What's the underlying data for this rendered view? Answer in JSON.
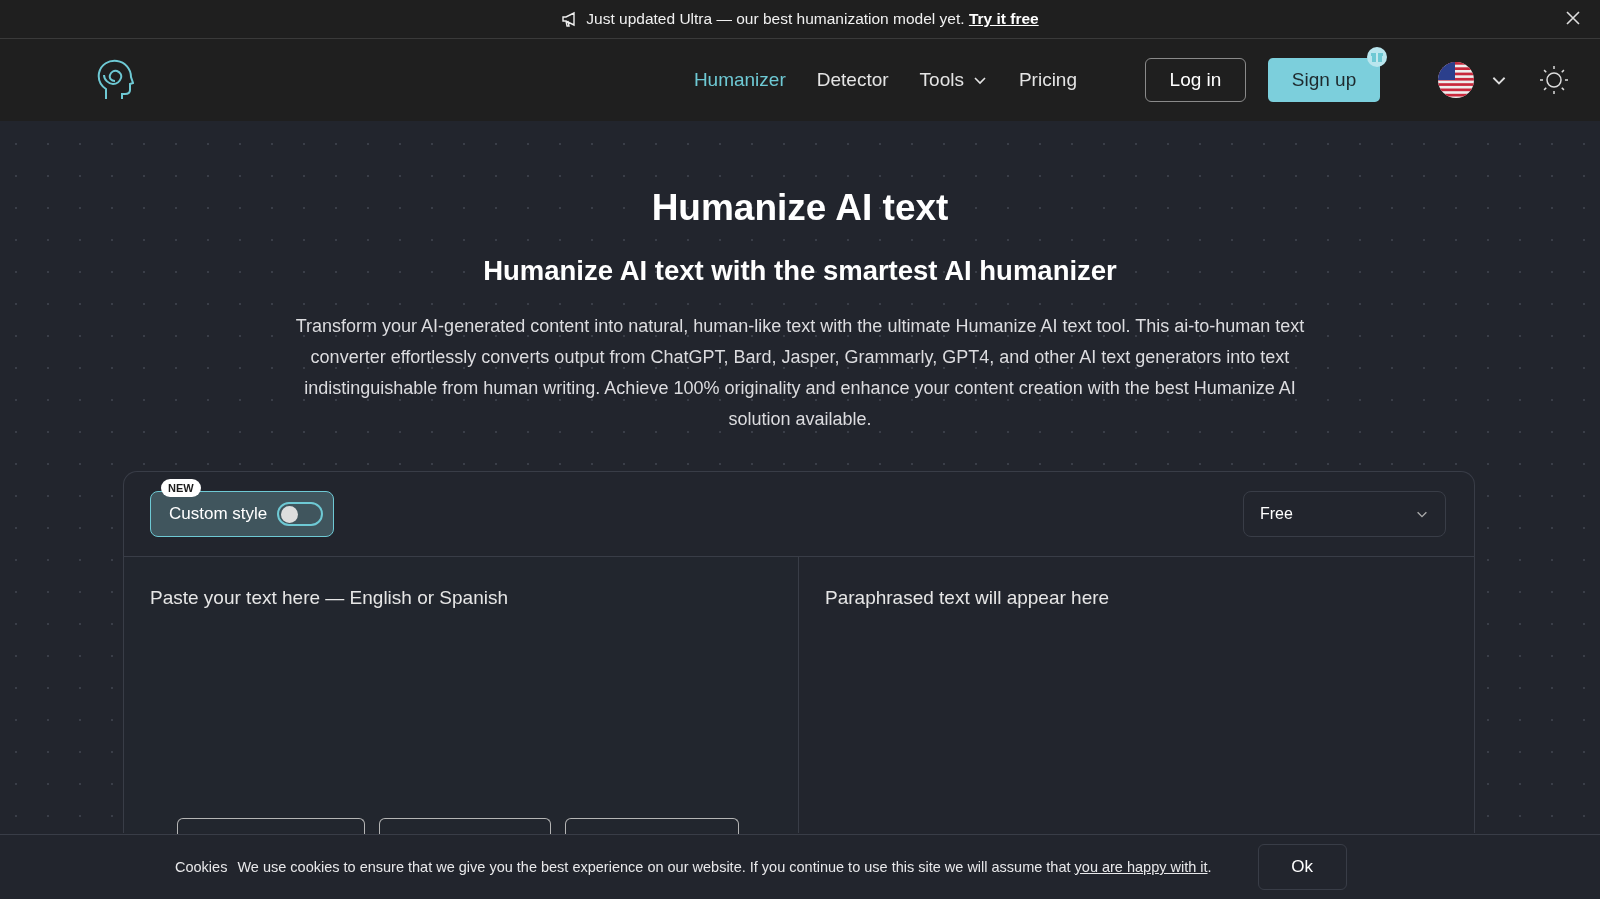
{
  "banner": {
    "text": "Just updated Ultra — our best humanization model yet.",
    "link": "Try it free"
  },
  "nav": {
    "items": [
      {
        "label": "Humanizer",
        "selected": true,
        "kind": "link"
      },
      {
        "label": "Detector",
        "selected": false,
        "kind": "link"
      },
      {
        "label": "Tools",
        "selected": false,
        "kind": "dropdown"
      },
      {
        "label": "Pricing",
        "selected": false,
        "kind": "link"
      }
    ],
    "login": "Log in",
    "signup": "Sign up"
  },
  "hero": {
    "title": "Humanize AI text",
    "subtitle": "Humanize AI text with the smartest AI humanizer",
    "description": "Transform your AI-generated content into natural, human-like text with the ultimate Humanize AI text tool. This ai-to-human text converter effortlessly converts output from ChatGPT, Bard, Jasper, Grammarly, GPT4, and other AI text generators into text indistinguishable from human writing. Achieve 100% originality and enhance your content creation with the best Humanize AI solution available."
  },
  "tool": {
    "custom_style": {
      "badge": "NEW",
      "label": "Custom style",
      "on": false
    },
    "mode": "Free",
    "input": {
      "placeholder": "Paste your text here — English or Spanish"
    },
    "output": {
      "placeholder": "Paraphrased text will appear here"
    }
  },
  "cookie": {
    "label": "Cookies",
    "text": "We use cookies to ensure that we give you the best experience on our website. If you continue to use this site we will assume that",
    "link": "you are happy with it",
    "after": ".",
    "button": "Ok"
  }
}
